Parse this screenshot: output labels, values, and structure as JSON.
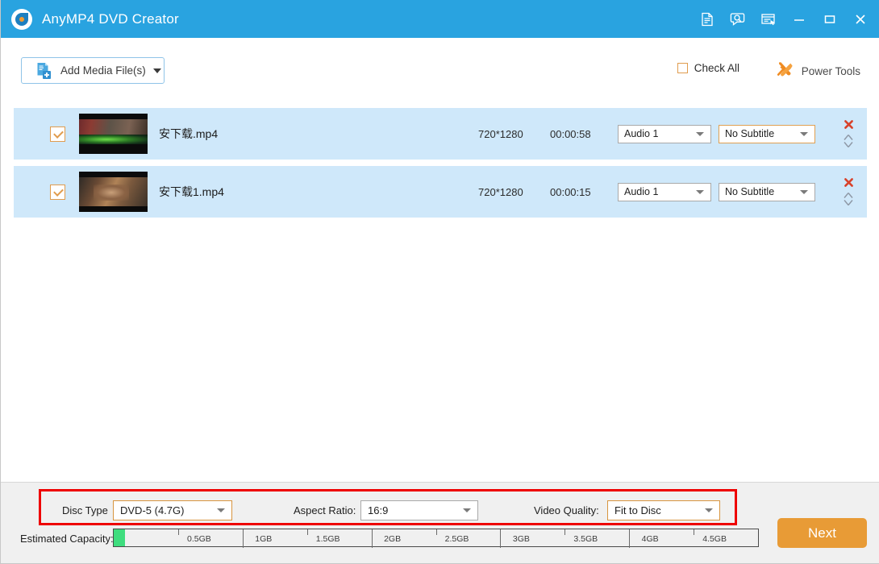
{
  "window": {
    "title": "AnyMP4 DVD Creator",
    "logo_icon": "anymp4-logo-icon",
    "controls": [
      {
        "name": "register-icon",
        "label": "Register"
      },
      {
        "name": "feedback-icon",
        "label": "Feedback"
      },
      {
        "name": "menu-icon",
        "label": "Menu"
      },
      {
        "name": "minimize-icon",
        "label": "Minimize"
      },
      {
        "name": "maximize-icon",
        "label": "Maximize"
      },
      {
        "name": "close-icon",
        "label": "Close"
      }
    ],
    "accent_color": "#29a3e0"
  },
  "toolbar": {
    "add_media_label": "Add Media File(s)",
    "add_media_icon": "add-file-icon",
    "add_media_caret": "chevron-down-icon",
    "check_all_label": "Check All",
    "check_all_checked": false,
    "power_tools_label": "Power Tools",
    "power_tools_icon": "tools-icon",
    "accent_color": "#e09c4e"
  },
  "file_list": {
    "columns": [
      "checkbox",
      "thumbnail",
      "name",
      "resolution",
      "duration",
      "audio",
      "subtitle",
      "actions"
    ],
    "rows": [
      {
        "checked": true,
        "thumbnail": "video-thumbnail-1",
        "name": "安下载.mp4",
        "resolution": "720*1280",
        "duration": "00:00:58",
        "audio": "Audio 1",
        "subtitle": "No Subtitle",
        "subtitle_highlight": true,
        "delete_icon": "close-icon",
        "sort_icon": "sort-updown-icon"
      },
      {
        "checked": true,
        "thumbnail": "video-thumbnail-2",
        "name": "安下载1.mp4",
        "resolution": "720*1280",
        "duration": "00:00:15",
        "audio": "Audio 1",
        "subtitle": "No Subtitle",
        "subtitle_highlight": false,
        "delete_icon": "close-icon",
        "sort_icon": "sort-updown-icon"
      }
    ]
  },
  "settings": {
    "highlight_box_color": "#ee0000",
    "disc_type_label": "Disc Type",
    "disc_type_value": "DVD-5 (4.7G)",
    "aspect_ratio_label": "Aspect Ratio:",
    "aspect_ratio_value": "16:9",
    "video_quality_label": "Video Quality:",
    "video_quality_value": "Fit to Disc"
  },
  "capacity": {
    "label": "Estimated Capacity:",
    "fill_color": "#3fdd7e",
    "fill_percent": 1.8,
    "ticks": [
      "0.5GB",
      "1GB",
      "1.5GB",
      "2GB",
      "2.5GB",
      "3GB",
      "3.5GB",
      "4GB",
      "4.5GB"
    ]
  },
  "footer": {
    "next_label": "Next",
    "next_color": "#e89b36"
  }
}
